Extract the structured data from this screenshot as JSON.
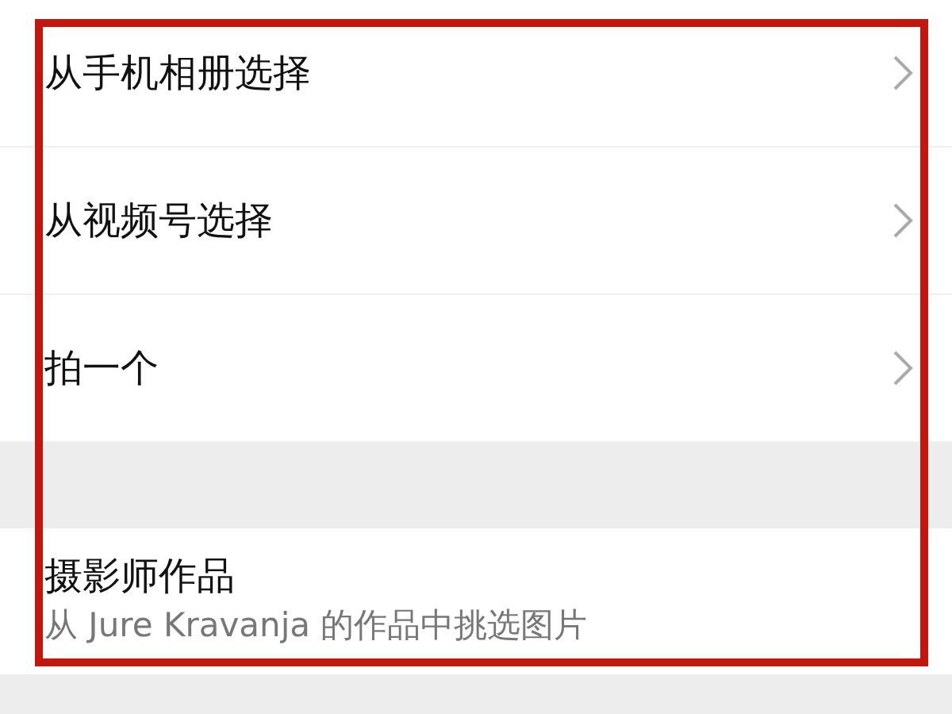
{
  "menu_items": [
    {
      "label": "从手机相册选择"
    },
    {
      "label": "从视频号选择"
    },
    {
      "label": "拍一个"
    }
  ],
  "featured": {
    "title": "摄影师作品",
    "subtitle": "从 Jure Kravanja 的作品中挑选图片"
  }
}
